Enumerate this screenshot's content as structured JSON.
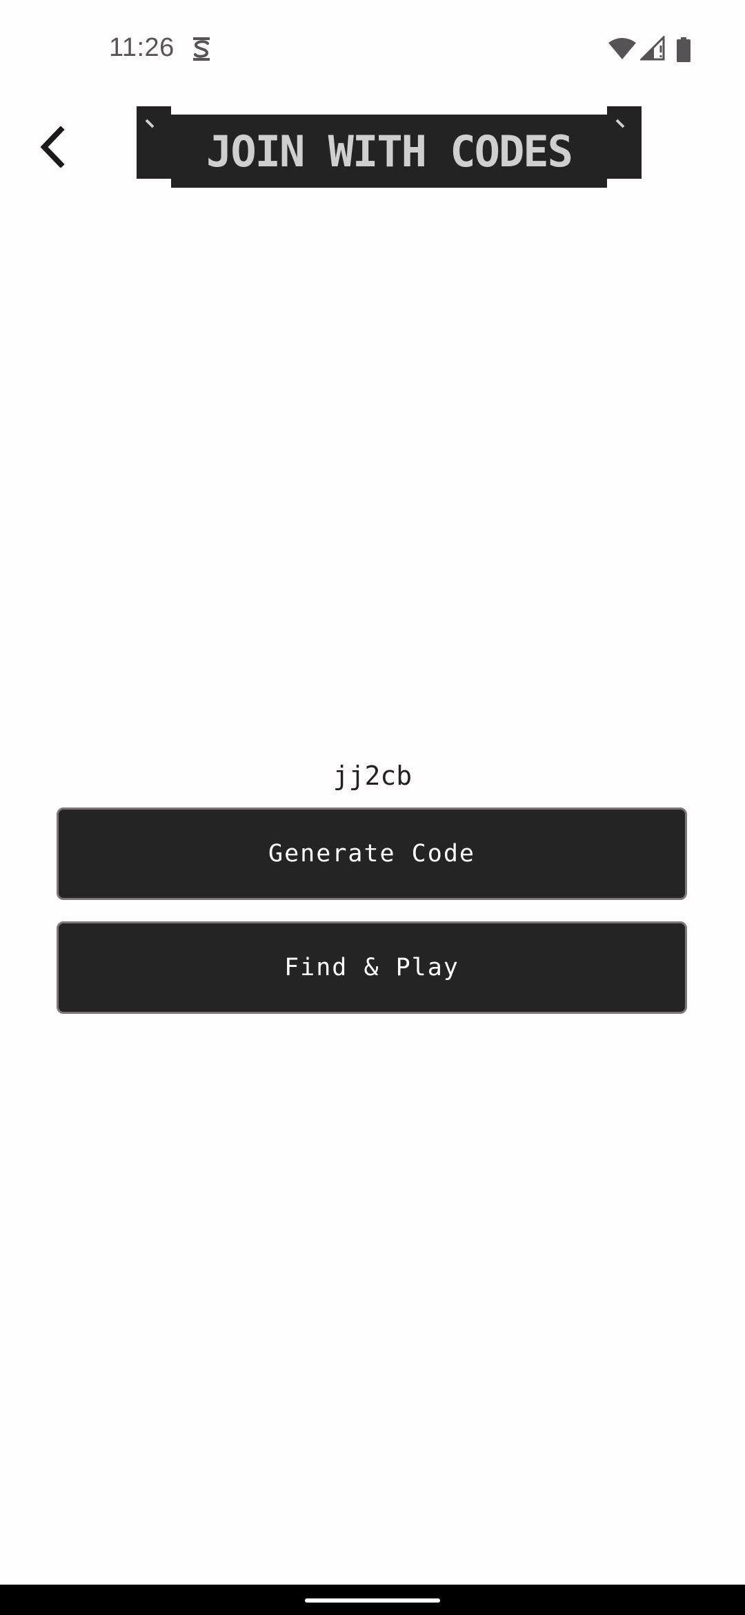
{
  "status_bar": {
    "time": "11:26",
    "icons": [
      "s-notification-icon",
      "wifi-icon",
      "cell-signal-icon",
      "battery-icon"
    ]
  },
  "header": {
    "back_icon": "chevron-left-icon",
    "title": "JOIN WITH CODES"
  },
  "main": {
    "code": "jj2cb",
    "generate_label": "Generate Code",
    "find_label": "Find & Play"
  },
  "colors": {
    "background": "#fffdfd",
    "banner": "#232323",
    "banner_text": "#cfcfcf",
    "button": "#242424",
    "button_border": "#7d777a",
    "button_text": "#ffffff"
  }
}
